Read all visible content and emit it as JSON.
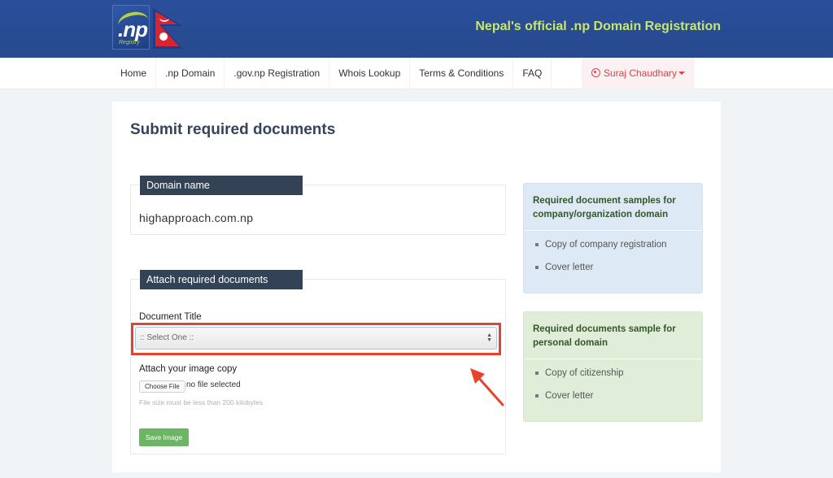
{
  "header": {
    "logo_text": ".np",
    "logo_subtext": "Registry",
    "tagline": "Nepal's official .np Domain Registration",
    "tagline_color": "#c8e66a",
    "brand_color": "#2a4f9a"
  },
  "nav": {
    "items": [
      {
        "label": "Home"
      },
      {
        "label": ".np Domain"
      },
      {
        "label": ".gov.np Registration"
      },
      {
        "label": "Whois Lookup"
      },
      {
        "label": "Terms & Conditions"
      },
      {
        "label": "FAQ"
      }
    ],
    "user": {
      "name": "Suraj Chaudhary",
      "icon": "user-circle-icon",
      "color": "#d9434f"
    }
  },
  "main": {
    "title": "Submit required documents",
    "domain_panel": {
      "label": "Domain name",
      "value": "highapproach.com.np"
    },
    "attach_panel": {
      "label": "Attach required documents",
      "document_title_label": "Document Title",
      "select_value": ":: Select One ::",
      "image_label": "Attach your image copy",
      "choose_file_label": "Choose File",
      "file_status": "no file selected",
      "help_text": "File size must be less than 200 kilobytes",
      "save_label": "Save Image",
      "save_color": "#6bb563"
    },
    "annotation": {
      "highlight_color": "#e8422c",
      "arrow_icon": "arrow-up-left-icon"
    }
  },
  "sidebar": {
    "company_box": {
      "title": "Required document samples for company/organization domain",
      "items": [
        "Copy of company registration",
        "Cover letter"
      ],
      "bg_color": "#dde9f4"
    },
    "personal_box": {
      "title": "Required documents sample for personal domain",
      "items": [
        "Copy of citizenship",
        "Cover letter"
      ],
      "bg_color": "#e0eed9"
    }
  }
}
